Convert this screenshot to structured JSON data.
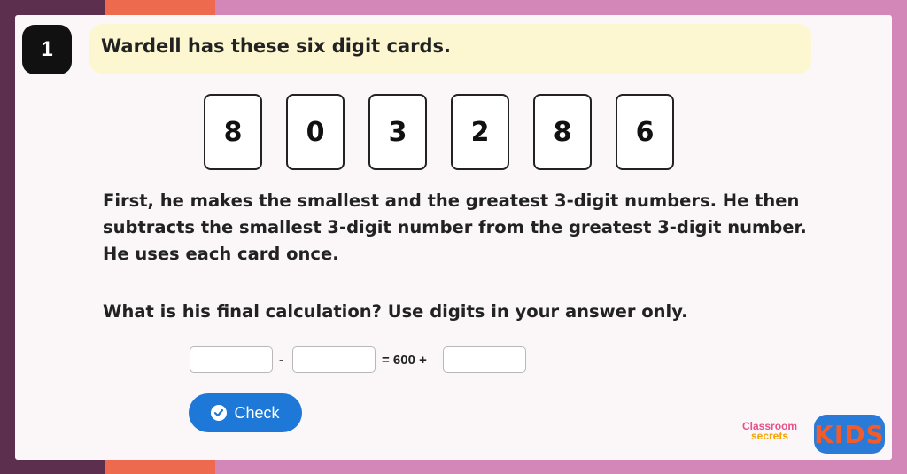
{
  "question": {
    "number": "1",
    "title": "Wardell has these six digit cards.",
    "digit_cards": [
      "8",
      "0",
      "3",
      "2",
      "8",
      "6"
    ],
    "paragraph": "First, he makes the smallest and the greatest 3-digit numbers. He then subtracts the smallest 3-digit number from the greatest 3-digit number. He uses each card once.",
    "prompt": "What is his final calculation? Use digits in your answer only."
  },
  "answer": {
    "box1_value": "",
    "minus_symbol": "-",
    "box2_value": "",
    "equals_text": "= 600 +",
    "box3_value": ""
  },
  "actions": {
    "check_label": "Check"
  },
  "branding": {
    "logo_line1": "Classroom",
    "logo_line2": "secrets",
    "kids_text": "KIDS"
  },
  "colors": {
    "accent": "#1d78d8",
    "banner": "#fcf7d0",
    "background": "#d287b8"
  }
}
